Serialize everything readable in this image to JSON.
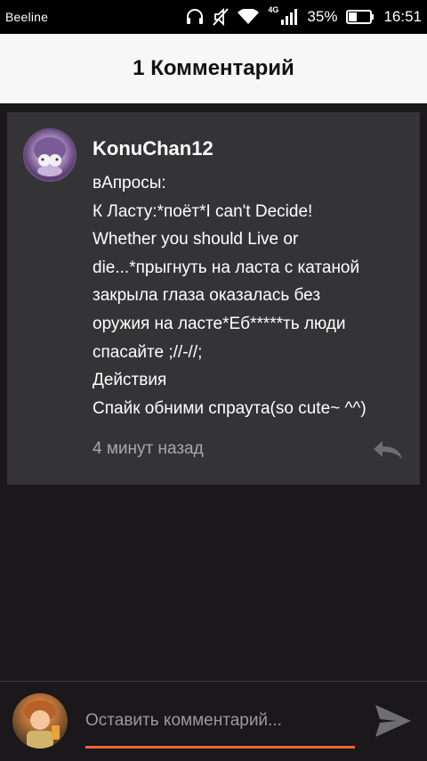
{
  "status_bar": {
    "carrier": "Beeline",
    "network_type": "4G",
    "battery_percent": "35%",
    "time": "16:51",
    "icons": [
      "headphones-icon",
      "mute-icon",
      "wifi-icon",
      "signal-icon",
      "battery-icon"
    ]
  },
  "header": {
    "title": "1 Комментарий"
  },
  "comment": {
    "author": "KonuChan12",
    "lines": [
      "вАпросы:",
      "К Ласту:*поёт*I can't Decide!",
      "Whether you should Live or",
      "die...*прыгнуть на ласта с катаной",
      "закрыла глаза оказалась без",
      "оружия на ласте*Еб*****ть люди",
      "спасайте ;//-//;",
      "Действия",
      "Спайк обними спраута(so cute~ ^^)"
    ],
    "time_ago": "4 минут назад",
    "reply_icon": "reply-icon"
  },
  "input_bar": {
    "placeholder": "Оставить комментарий...",
    "value": "",
    "send_icon": "send-icon"
  },
  "colors": {
    "background": "#1a181b",
    "card": "#343436",
    "header": "#f7f7f7",
    "accent": "#e8663a",
    "muted_text": "#a8a8a8"
  }
}
